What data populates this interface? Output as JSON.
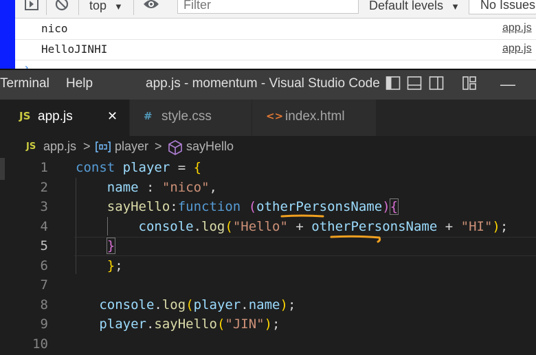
{
  "devtools": {
    "context": "top",
    "filter_placeholder": "Filter",
    "levels": "Default levels",
    "issues": "No Issues",
    "logs": [
      {
        "message": "nico",
        "source": "app.js"
      },
      {
        "message": "HelloJINHI",
        "source": "app.js"
      }
    ],
    "icons": [
      "sidebar-icon",
      "clear-console-icon",
      "dropdown-icon",
      "eye-icon"
    ]
  },
  "titlebar": {
    "menus": [
      "Terminal",
      "Help"
    ],
    "title": "app.js - momentum - Visual Studio Code",
    "minimize": "—"
  },
  "tabs": [
    {
      "icon": "JS",
      "label": "app.js",
      "active": true,
      "close": "✕"
    },
    {
      "icon": "#",
      "label": "style.css",
      "active": false
    },
    {
      "icon": "<>",
      "label": "index.html",
      "active": false
    }
  ],
  "breadcrumb": {
    "file_icon": "JS",
    "file": "app.js",
    "sep1": ">",
    "variable": "player",
    "sep2": ">",
    "method": "sayHello"
  },
  "editor": {
    "line_numbers": [
      "1",
      "2",
      "3",
      "4",
      "5",
      "6",
      "7",
      "8",
      "9",
      "10"
    ],
    "current_line": 5,
    "lines": [
      "const player = {",
      "    name : \"nico\",",
      "    sayHello:function (otherPersonsName){",
      "        console.log(\"Hello\" + otherPersonsName + \"HI\");",
      "    }",
      "    };",
      "",
      "    console.log(player.name);",
      "    player.sayHello(\"JIN\");",
      ""
    ]
  },
  "colors": {
    "keyword": "#569cd6",
    "variable": "#9cdcfe",
    "function": "#dcdcaa",
    "string": "#ce9178",
    "bracket": "#ffd700",
    "squiggle": "#f0a020",
    "squiggle_cursor": "#ff8c00"
  }
}
